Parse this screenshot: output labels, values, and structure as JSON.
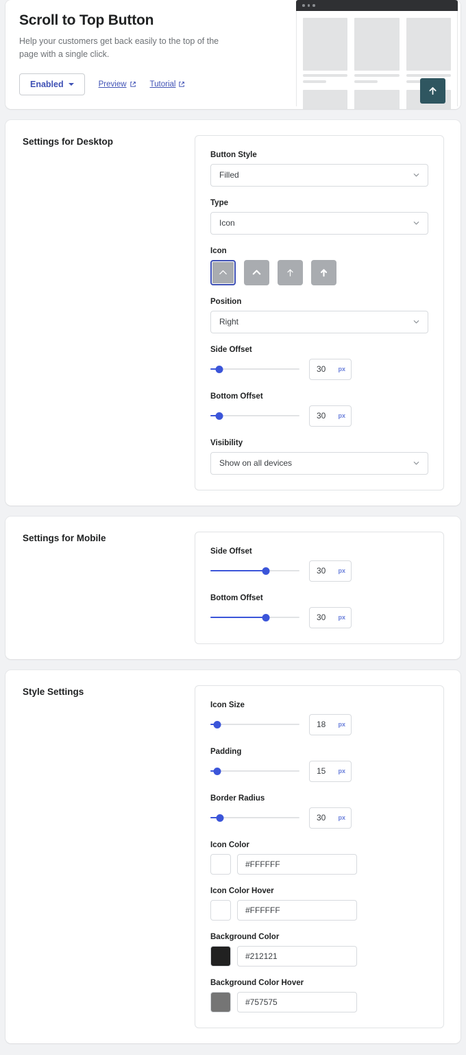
{
  "header": {
    "title": "Scroll to Top Button",
    "subtitle": "Help your customers get back easily to the top of the page with a single click.",
    "enabled_label": "Enabled",
    "preview_link": "Preview",
    "tutorial_link": "Tutorial"
  },
  "preview": {
    "button_color": "#2F5660",
    "arrow_icon": "arrow-up-icon"
  },
  "desktop": {
    "section_title": "Settings for Desktop",
    "button_style": {
      "label": "Button Style",
      "value": "Filled"
    },
    "type": {
      "label": "Type",
      "value": "Icon"
    },
    "icon": {
      "label": "Icon",
      "options": [
        "chevron-up-thin",
        "chevron-up-bold",
        "arrow-up-thin",
        "arrow-up-bold"
      ],
      "selected_index": 0
    },
    "position": {
      "label": "Position",
      "value": "Right"
    },
    "side_offset": {
      "label": "Side Offset",
      "value": "30",
      "unit": "px",
      "percent": 10
    },
    "bottom_offset": {
      "label": "Bottom Offset",
      "value": "30",
      "unit": "px",
      "percent": 10
    },
    "visibility": {
      "label": "Visibility",
      "value": "Show on all devices"
    }
  },
  "mobile": {
    "section_title": "Settings for Mobile",
    "side_offset": {
      "label": "Side Offset",
      "value": "30",
      "unit": "px",
      "percent": 62
    },
    "bottom_offset": {
      "label": "Bottom Offset",
      "value": "30",
      "unit": "px",
      "percent": 62
    }
  },
  "style": {
    "section_title": "Style Settings",
    "icon_size": {
      "label": "Icon Size",
      "value": "18",
      "unit": "px",
      "percent": 8
    },
    "padding": {
      "label": "Padding",
      "value": "15",
      "unit": "px",
      "percent": 8
    },
    "border_radius": {
      "label": "Border Radius",
      "value": "30",
      "unit": "px",
      "percent": 11
    },
    "icon_color": {
      "label": "Icon Color",
      "value": "#FFFFFF",
      "swatch": "#FFFFFF"
    },
    "icon_color_hover": {
      "label": "Icon Color Hover",
      "value": "#FFFFFF",
      "swatch": "#FFFFFF"
    },
    "background_color": {
      "label": "Background Color",
      "value": "#212121",
      "swatch": "#212121"
    },
    "background_color_hover": {
      "label": "Background Color Hover",
      "value": "#757575",
      "swatch": "#757575"
    }
  }
}
